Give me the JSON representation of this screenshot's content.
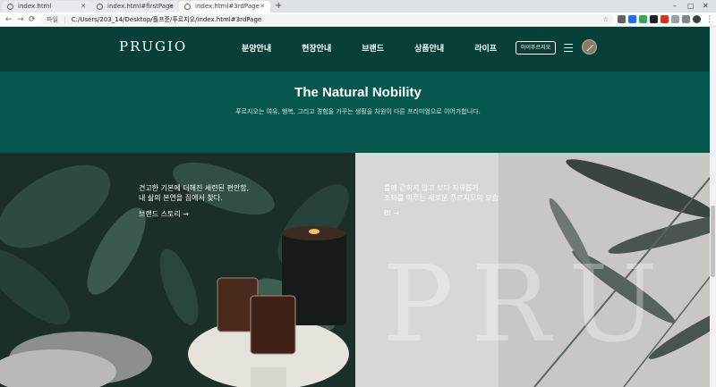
{
  "browser": {
    "tabs": [
      {
        "title": "index.html"
      },
      {
        "title": "index.html#firstPage"
      },
      {
        "title": "index.html#3rdPage"
      }
    ],
    "new_tab_icon": "+",
    "window_controls": [
      "–",
      "□",
      "✕"
    ],
    "nav": {
      "back": "←",
      "forward": "→",
      "reload": "⟳"
    },
    "address": {
      "info_label": "파일",
      "url": "C:/Users/203_14/Desktop/플프준/푸르지오/index.html#3rdPage"
    },
    "toolbar_icons": [
      "camera-icon",
      "star-icon",
      "extension-icons",
      "profile-icon",
      "menu-icon"
    ]
  },
  "site": {
    "logo": "PRUGIO",
    "nav": [
      "분양안내",
      "현장안내",
      "브랜드",
      "상품안내",
      "라이프"
    ],
    "mypage_button": "마이푸르지오",
    "hero": {
      "title": "The Natural Nobility",
      "subtitle": "푸르지오는 여유, 행복, 그리고 경험을 가꾸는 생활을 차원이 다른 프리미엄으로 이어가합니다."
    },
    "panels": [
      {
        "line1": "견고한 기본에 더해진 세련된 편안함,",
        "line2": "내 삶의 본연을 집에서 찾다.",
        "link": "브랜드 스토리 →"
      },
      {
        "line1": "틀에 갇히지 않고 보다 자유롭게",
        "line2": "조화를 이루는 새로운 푸르지오의 모습",
        "link": "BI →",
        "watermark": "PRU"
      }
    ]
  },
  "colors": {
    "header_bg": "#063f37",
    "hero_bg": "#06574d"
  }
}
